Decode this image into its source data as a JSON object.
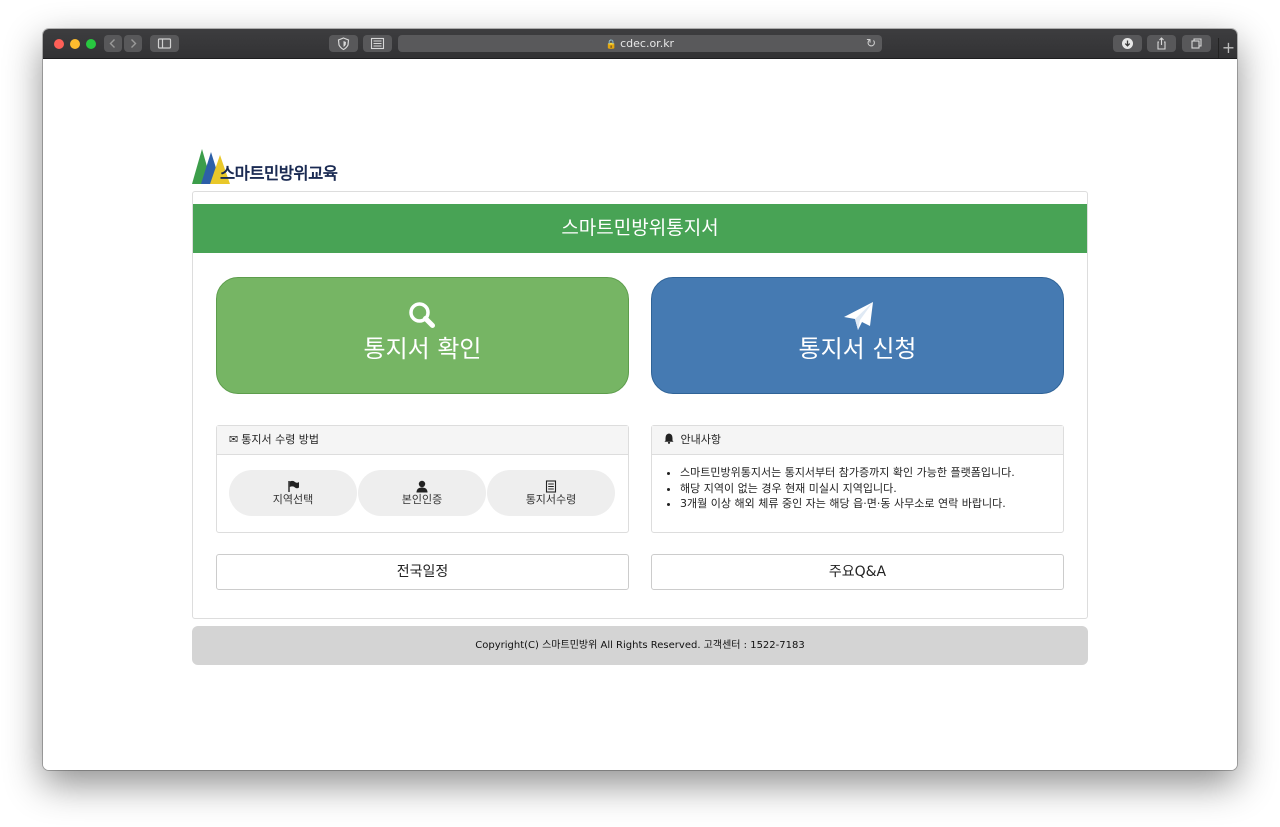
{
  "browser": {
    "url": "cdec.or.kr",
    "traffic_lights": [
      "#fe5f57",
      "#febc2e",
      "#28c840"
    ]
  },
  "logo": {
    "text": "스마트민방위교육"
  },
  "panel": {
    "title": "스마트민방위통지서",
    "accent": "#48a355"
  },
  "actions": {
    "check": {
      "label": "통지서 확인",
      "icon": "search-icon",
      "color": "#76b564"
    },
    "apply": {
      "label": "통지서 신청",
      "icon": "paper-plane-icon",
      "color": "#457ab2"
    }
  },
  "receive_methods": {
    "heading": "통지서 수령 방법",
    "icon": "envelope-icon",
    "steps": [
      {
        "label": "지역선택",
        "icon": "flag-icon"
      },
      {
        "label": "본인인증",
        "icon": "user-icon"
      },
      {
        "label": "통지서수령",
        "icon": "document-icon"
      }
    ]
  },
  "notices": {
    "heading": "안내사항",
    "icon": "bell-icon",
    "items": [
      "스마트민방위통지서는 통지서부터 참가증까지 확인 가능한 플랫폼입니다.",
      "해당 지역이 없는 경우 현재 미실시 지역입니다.",
      "3개월 이상 해외 체류 중인 자는 해당 읍·면·동 사무소로 연락 바랍니다."
    ]
  },
  "links": {
    "schedule": "전국일정",
    "qna": "주요Q&A"
  },
  "footer": {
    "text": "Copyright(C) 스마트민방위 All Rights Reserved. 고객센터 : 1522-7183"
  }
}
